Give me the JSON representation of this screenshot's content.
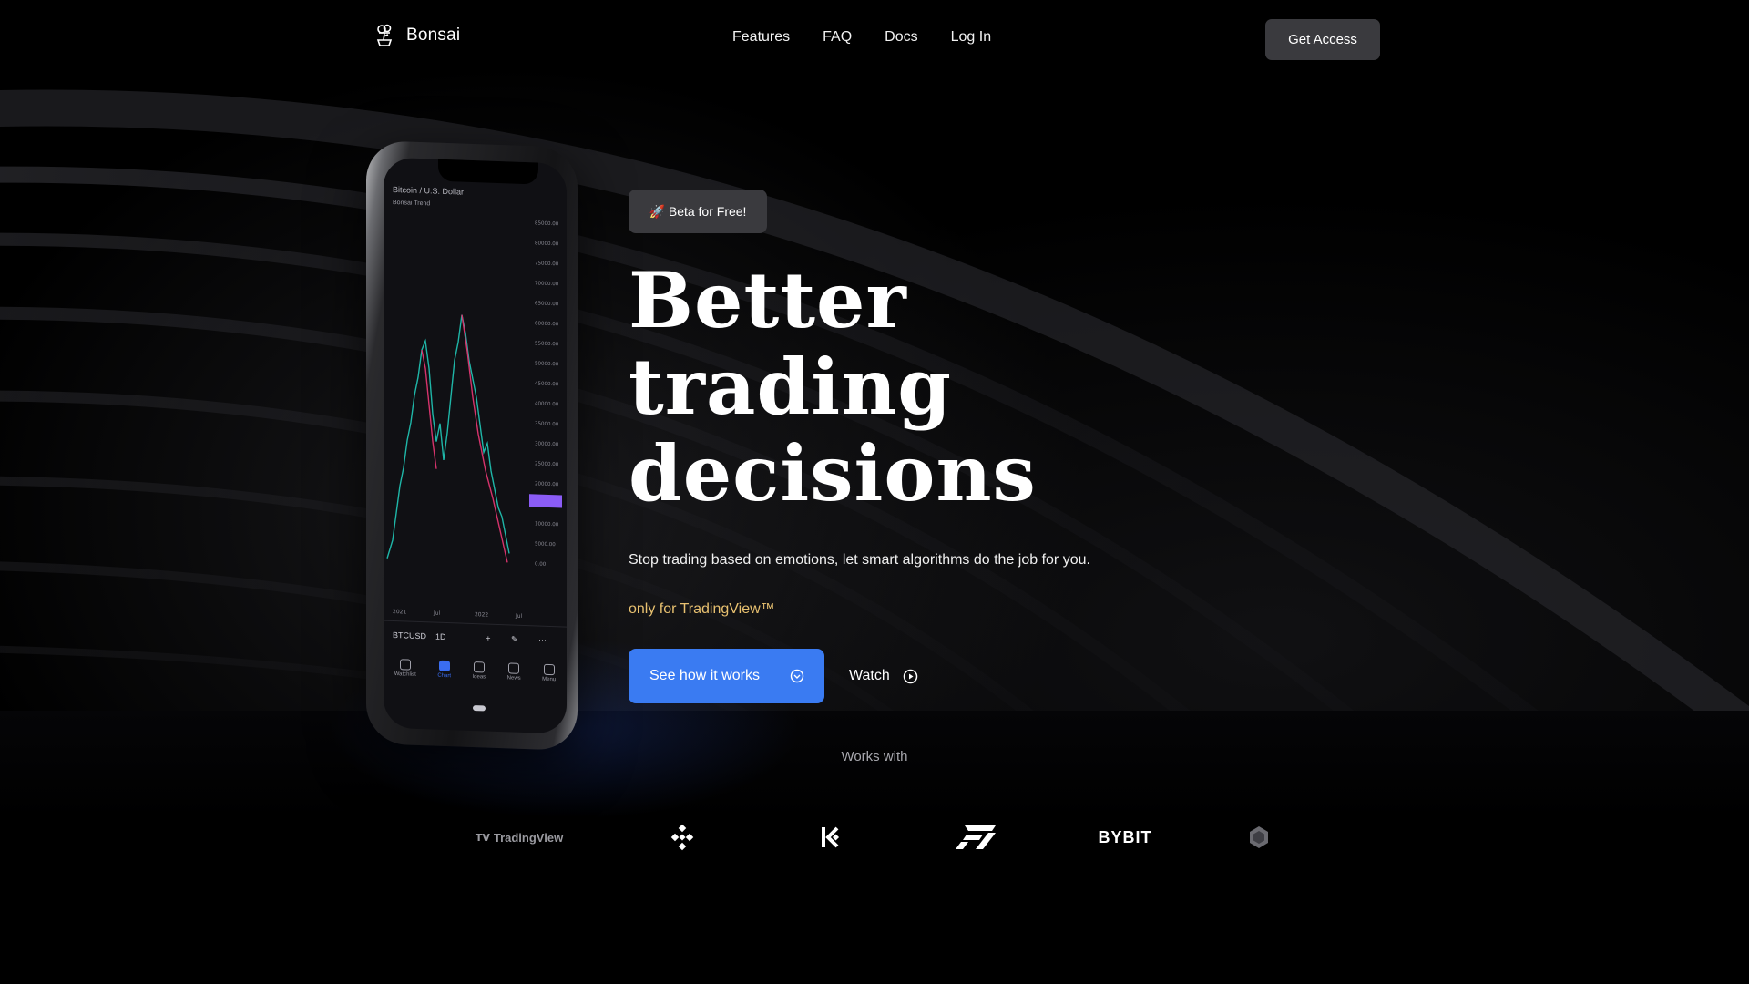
{
  "nav": {
    "brand": "Bonsai",
    "links": [
      "Features",
      "FAQ",
      "Docs",
      "Log In"
    ],
    "cta": "Get Access"
  },
  "phone": {
    "chart_title": "Bitcoin / U.S. Dollar",
    "chart_subtitle": "Bonsai Trend",
    "price_labels": [
      "85000.00",
      "80000.00",
      "75000.00",
      "70000.00",
      "65000.00",
      "60000.00",
      "55000.00",
      "50000.00",
      "45000.00",
      "40000.00",
      "35000.00",
      "30000.00",
      "25000.00",
      "20000.00",
      "15000.00",
      "10000.00",
      "5000.00",
      "0.00"
    ],
    "time_labels": [
      "2021",
      "Jul",
      "2022",
      "Jul"
    ],
    "ticker": "BTCUSD",
    "interval": "1D",
    "tabs": [
      "Watchlist",
      "Chart",
      "Ideas",
      "News",
      "Menu"
    ]
  },
  "hero": {
    "badge": "🚀 Beta for Free!",
    "headline": [
      "Better",
      "trading",
      "decisions"
    ],
    "subtitle": "Stop trading based on emotions, let smart algorithms do the job for you.",
    "note": "only for TradingView™",
    "primary_button": "See how it works",
    "watch_button": "Watch"
  },
  "works_with": {
    "label": "Works with",
    "logos": [
      "TradingView",
      "Binance",
      "KuCoin",
      "FTX",
      "BYBIT",
      "Other exchange"
    ]
  },
  "colors": {
    "accent": "#3a7bf2",
    "note": "#e8c170",
    "button_dark": "#3a3a3e"
  }
}
